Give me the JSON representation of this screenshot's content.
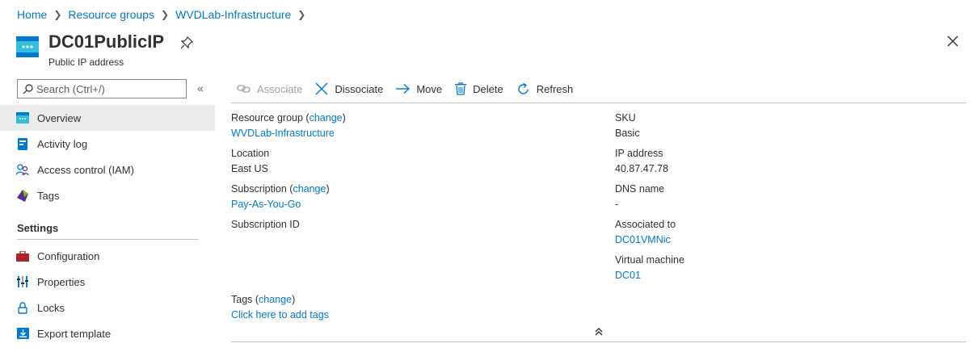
{
  "breadcrumb": [
    "Home",
    "Resource groups",
    "WVDLab-Infrastructure"
  ],
  "resource": {
    "title": "DC01PublicIP",
    "subtitle": "Public IP address"
  },
  "search": {
    "placeholder": "Search (Ctrl+/)"
  },
  "nav": {
    "items": [
      {
        "label": "Overview"
      },
      {
        "label": "Activity log"
      },
      {
        "label": "Access control (IAM)"
      },
      {
        "label": "Tags"
      }
    ],
    "settings_header": "Settings",
    "settings_items": [
      {
        "label": "Configuration"
      },
      {
        "label": "Properties"
      },
      {
        "label": "Locks"
      },
      {
        "label": "Export template"
      }
    ]
  },
  "toolbar": {
    "associate": "Associate",
    "dissociate": "Dissociate",
    "move": "Move",
    "delete": "Delete",
    "refresh": "Refresh"
  },
  "essentials": {
    "resource_group_label": "Resource group",
    "resource_group_value": "WVDLab-Infrastructure",
    "change_label": "change",
    "location_label": "Location",
    "location_value": "East US",
    "subscription_label": "Subscription",
    "subscription_value": "Pay-As-You-Go",
    "subscription_id_label": "Subscription ID",
    "sku_label": "SKU",
    "sku_value": "Basic",
    "ip_label": "IP address",
    "ip_value": "40.87.47.78",
    "dns_label": "DNS name",
    "dns_value": "-",
    "associated_label": "Associated to",
    "associated_value": "DC01VMNic",
    "vm_label": "Virtual machine",
    "vm_value": "DC01",
    "tags_label": "Tags",
    "tags_value": "Click here to add tags"
  },
  "colors": {
    "accent": "#0078d4",
    "selected_bg": "#ebebeb"
  }
}
